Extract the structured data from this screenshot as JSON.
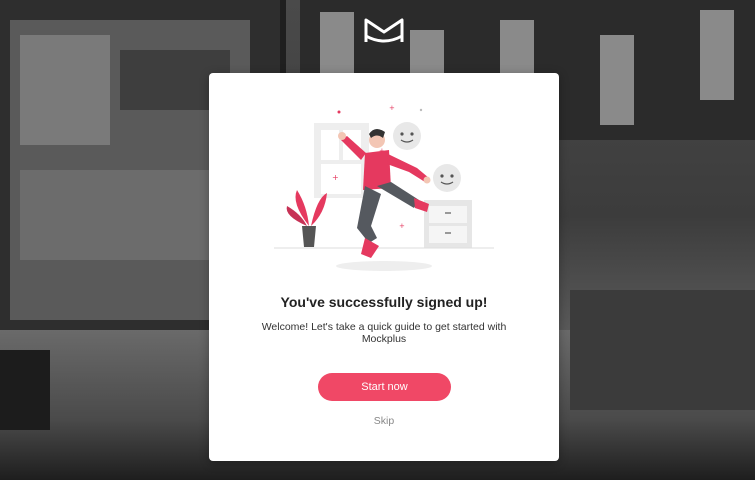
{
  "modal": {
    "title": "You've successfully signed up!",
    "description": "Welcome! Let's take a quick guide to get started with Mockplus",
    "start_label": "Start now",
    "skip_label": "Skip"
  },
  "colors": {
    "accent": "#f04866",
    "overlay": "#3a3a3a",
    "modal_bg": "#ffffff"
  },
  "icons": {
    "logo": "mockplus-logo-icon",
    "illustration": "celebration-illustration"
  }
}
